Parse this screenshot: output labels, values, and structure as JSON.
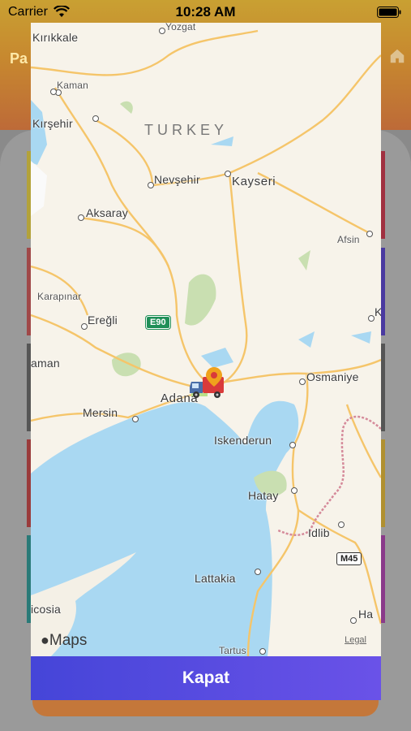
{
  "status_bar": {
    "carrier": "Carrier",
    "time": "10:28 AM"
  },
  "background": {
    "title_fragment": "Pa"
  },
  "map": {
    "country_label": "TURKEY",
    "places": [
      {
        "name": "Kırıkkale",
        "key": "kirikkale"
      },
      {
        "name": "Yozgat",
        "key": "yozgat"
      },
      {
        "name": "Kaman",
        "key": "kaman"
      },
      {
        "name": "Kırşehir",
        "key": "kirsehir"
      },
      {
        "name": "Nevşehir",
        "key": "nevsehir"
      },
      {
        "name": "Kayseri",
        "key": "kayseri"
      },
      {
        "name": "Aksaray",
        "key": "aksaray"
      },
      {
        "name": "Afsin",
        "key": "afsin"
      },
      {
        "name": "Karapınar",
        "key": "karapinar"
      },
      {
        "name": "Ereğli",
        "key": "eregli"
      },
      {
        "name": "aman",
        "key": "karaman"
      },
      {
        "name": "Adana",
        "key": "adana"
      },
      {
        "name": "Osmaniye",
        "key": "osmaniye"
      },
      {
        "name": "Mersin",
        "key": "mersin"
      },
      {
        "name": "Iskenderun",
        "key": "iskenderun"
      },
      {
        "name": "Hatay",
        "key": "hatay"
      },
      {
        "name": "Idlib",
        "key": "idlib"
      },
      {
        "name": "Lattakia",
        "key": "lattakia"
      },
      {
        "name": "icosia",
        "key": "nicosia"
      },
      {
        "name": "Tartus",
        "key": "tartus"
      },
      {
        "name": "Ha",
        "key": "hama"
      },
      {
        "name": "K",
        "key": "kahramanmaras"
      }
    ],
    "road_shields": {
      "e90": "E90",
      "m45": "M45"
    },
    "attribution": "Maps",
    "legal": "Legal",
    "marker_icon": "truck-location-pin"
  },
  "close_button": {
    "label": "Kapat"
  },
  "colors": {
    "accent": "#5a4ce0",
    "water": "#a9d8f2",
    "land": "#f7f3ea",
    "road": "#f5c56a",
    "park": "#c9dfb1"
  }
}
